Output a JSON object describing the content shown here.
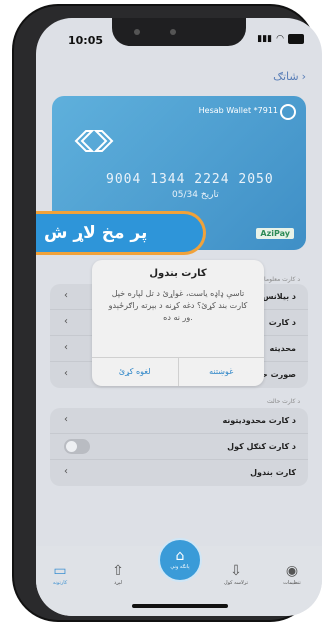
{
  "status": {
    "time": "10:05"
  },
  "nav": {
    "back_label": "شاتګ"
  },
  "card": {
    "wallet": "Hesab Wallet *7911",
    "number": "9004 1344 2224 2050",
    "expiry_label": "تاریخ",
    "expiry": "05/34",
    "payment_brand": "AziPay"
  },
  "banner": {
    "text": "پر مخ لاړ ش"
  },
  "settings": {
    "section1_title": "د کارت معلومات",
    "rows1": [
      {
        "label": "د بیلانس"
      },
      {
        "label": "د کارت"
      },
      {
        "label": "محدیته"
      },
      {
        "label": "صورت حسابونه"
      }
    ],
    "section2_title": "د کارت حالت",
    "rows2": [
      {
        "label": "د کارت محدودیتونه"
      },
      {
        "label": "د کارت کنګل کول"
      },
      {
        "label": "کارت بندول"
      }
    ]
  },
  "dialog": {
    "title": "کارت بندول",
    "message": "تاسې ډاډه یاست، غواړئ د تل لپاره خپل کارت بند کړئ؟ دغه کړنه د بېرته راګرځېدو ور نه ده.",
    "confirm_label": "غوښتنه",
    "cancel_label": "لغوه کړئ"
  },
  "tabs": {
    "t1": "کارتونه",
    "t2": "لېږد",
    "center": "پانګه ونې",
    "t4": "ترلاسه کول",
    "t5": "تنظیمات"
  },
  "colors": {
    "accent": "#3a9bd8",
    "banner_border": "#f1a23a"
  }
}
